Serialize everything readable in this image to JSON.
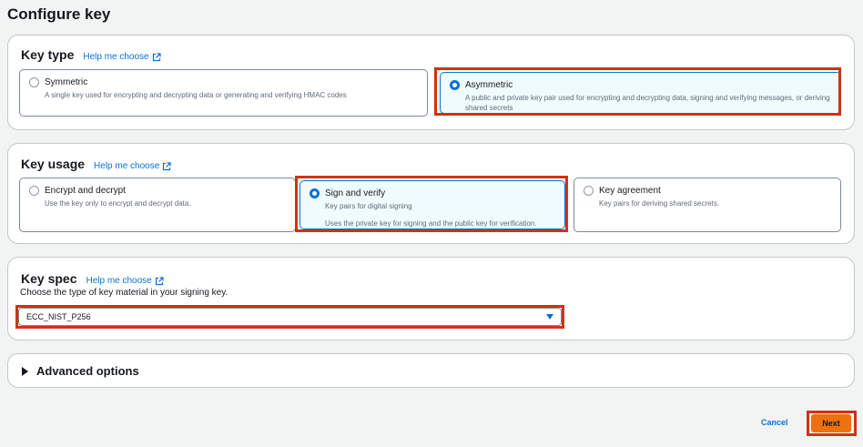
{
  "page": {
    "title": "Configure key"
  },
  "key_type": {
    "title": "Key type",
    "help_link": "Help me choose",
    "options": [
      {
        "label": "Symmetric",
        "description": "A single key used for encrypting and decrypting data or generating and verifying HMAC codes",
        "selected": false
      },
      {
        "label": "Asymmetric",
        "description": "A public and private key pair used for encrypting and decrypting data, signing and verifying messages, or deriving shared secrets",
        "selected": true
      }
    ]
  },
  "key_usage": {
    "title": "Key usage",
    "help_link": "Help me choose",
    "options": [
      {
        "label": "Encrypt and decrypt",
        "description": "Use the key only to encrypt and decrypt data.",
        "selected": false
      },
      {
        "label": "Sign and verify",
        "description": "Key pairs for digital signing",
        "extra": "Uses the private key for signing and the public key for verification.",
        "selected": true
      },
      {
        "label": "Key agreement",
        "description": "Key pairs for deriving shared secrets.",
        "selected": false
      }
    ]
  },
  "key_spec": {
    "title": "Key spec",
    "help_link": "Help me choose",
    "description": "Choose the type of key material in your signing key.",
    "selected_value": "ECC_NIST_P256"
  },
  "advanced": {
    "label": "Advanced options"
  },
  "footer": {
    "cancel_label": "Cancel",
    "next_label": "Next"
  },
  "colors": {
    "accent": "#0972d3",
    "primary_button": "#ec7211",
    "annotation": "#d13212"
  }
}
